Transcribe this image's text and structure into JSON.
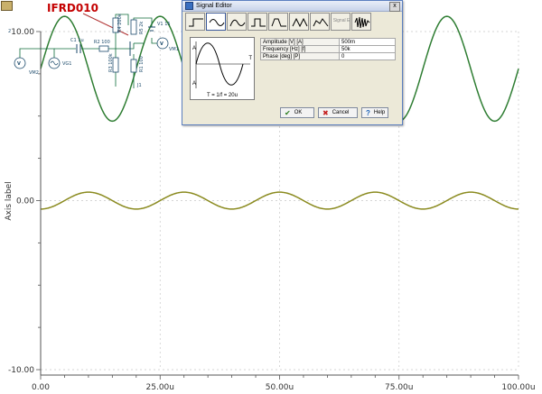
{
  "chart_data": {
    "type": "line",
    "ylabel": "Axis label",
    "xlim": [
      0,
      100
    ],
    "ylim": [
      -10,
      10
    ],
    "x_ticks": [
      0,
      25,
      50,
      75,
      100
    ],
    "x_tick_labels": [
      "0.00",
      "25.00u",
      "50.00u",
      "75.00u",
      "100.00u"
    ],
    "y_ticks": [
      -10,
      0,
      10
    ],
    "y_tick_labels": [
      "-10.00",
      "0.00",
      "10.00"
    ],
    "grid": true,
    "series": [
      {
        "color": "#2e7d32",
        "offset": 7.8,
        "amplitude": 3.1,
        "period": 20,
        "phase_deg": 0
      },
      {
        "color": "#8a8a1e",
        "offset": 0.0,
        "amplitude": 0.5,
        "period": 20,
        "phase_deg": -90
      }
    ]
  },
  "annotation": {
    "label": "IFRD010"
  },
  "schematic_labels": {
    "vm2": "VM2",
    "vg1": "VG1",
    "c1": "C1 1u",
    "r2": "R2 100",
    "r4": "R4 200k",
    "r3": "R3 100k",
    "r1": "R1 100",
    "j1": "J1",
    "r5": "R5 2k",
    "v1": "V1 15",
    "vm1": "VM1",
    "frag_2": "2"
  },
  "signal_editor": {
    "title": "Signal Editor",
    "toolbar_disabled_label": "Signal E",
    "amplitude_label": "Amplitude [V] [A]",
    "amplitude_value": "500m",
    "frequency_label": "Frequency [Hz] [f]",
    "frequency_value": "50k",
    "phase_label": "Phase [deg] [P]",
    "phase_value": "0",
    "preview_formula": "T = 1/f = 20u",
    "preview_a_top": "A",
    "preview_a_bottom": "A",
    "preview_t": "T",
    "ok_label": "OK",
    "cancel_label": "Cancel",
    "help_label": "Help",
    "close_glyph": "x"
  },
  "icons": {
    "ok": "check-icon",
    "cancel": "x-icon",
    "help": "question-icon"
  }
}
